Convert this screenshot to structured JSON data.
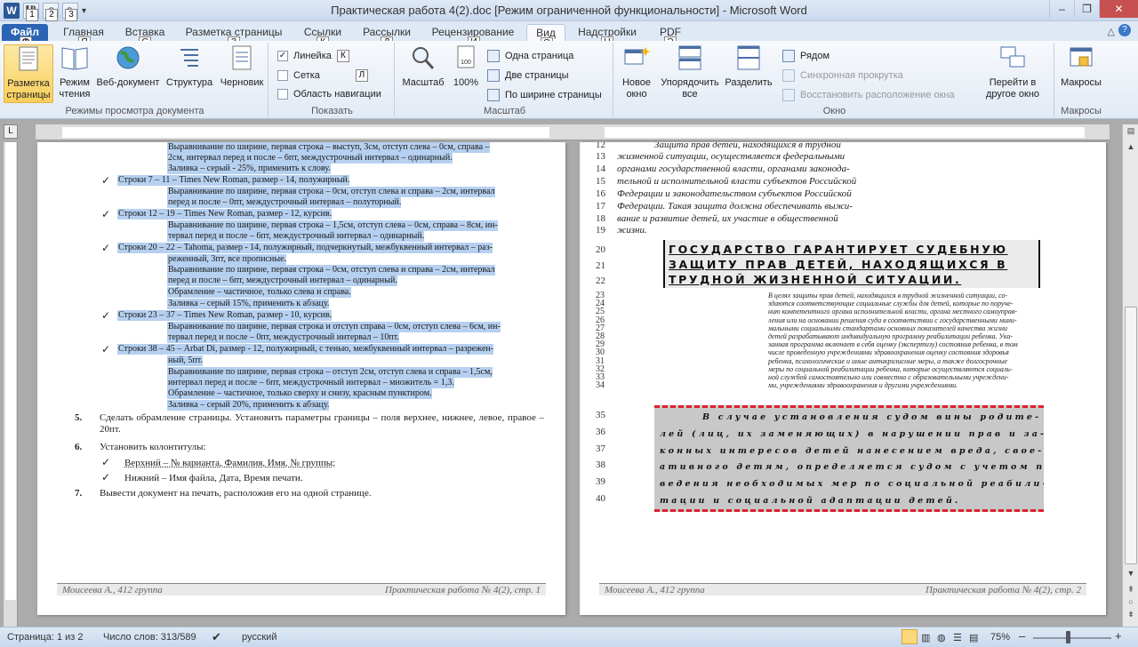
{
  "window": {
    "title": "Практическая работа 4(2).doc [Режим ограниченной функциональности]  -  Microsoft Word",
    "minimize": "–",
    "maximize": "❐",
    "close": "✕"
  },
  "qat": {
    "app_letter": "W",
    "keytips": [
      "1",
      "2",
      "3"
    ]
  },
  "tabs": [
    {
      "label": "Файл",
      "keytip": "Ф"
    },
    {
      "label": "Главная",
      "keytip": "Я"
    },
    {
      "label": "Вставка",
      "keytip": "С"
    },
    {
      "label": "Разметка страницы",
      "keytip": "З"
    },
    {
      "label": "Ссылки",
      "keytip": "К"
    },
    {
      "label": "Рассылки",
      "keytip": "Л"
    },
    {
      "label": "Рецензирование",
      "keytip": "И"
    },
    {
      "label": "Вид",
      "keytip": "О"
    },
    {
      "label": "Надстройки",
      "keytip": "Н"
    },
    {
      "label": "PDF",
      "keytip": "Э"
    }
  ],
  "ribbon": {
    "view_modes": {
      "label": "Режимы просмотра документа",
      "buttons": [
        "Разметка страницы",
        "Режим чтения",
        "Веб-документ",
        "Структура",
        "Черновик"
      ]
    },
    "show": {
      "label": "Показать",
      "items": [
        {
          "label": "Линейка",
          "checked": true
        },
        {
          "label": "Сетка",
          "checked": false
        },
        {
          "label": "Область навигации",
          "checked": false
        }
      ]
    },
    "zoom": {
      "label": "Масштаб",
      "zoom_btn": "Масштаб",
      "hundred_btn": "100%",
      "items": [
        "Одна страница",
        "Две страницы",
        "По ширине страницы"
      ]
    },
    "window": {
      "label": "Окно",
      "buttons": [
        "Новое окно",
        "Упорядочить все",
        "Разделить"
      ],
      "items": [
        "Рядом",
        "Синхронная прокрутка",
        "Восстановить расположение окна"
      ],
      "switch_btn": "Перейти в другое окно"
    },
    "macros": {
      "label": "Макросы",
      "button": "Макросы"
    }
  },
  "page1": {
    "selected_lines": [
      "Выравнивание по ширине, первая строка – выступ, 3см, отступ слева – 0см, справа –",
      "2см, интервал перед и после – 6пт, междустрочный интервал – одинарный.",
      "Заливка – серый - 25%, применить к слову.",
      "Строки 7 – 11 – Times New Roman, размер - 14, полужирный.",
      "Выравнивание по ширине, первая строка – 0см, отступ слева и справа – 2см, интервал",
      "перед и после – 0пт, междустрочный интервал – полуторный.",
      "Строки 12 – 19 – Times New Roman, размер - 12, курсив.",
      "Выравнивание по ширине, первая строка – 1,5см, отступ слева – 0см, справа – 8см, ин-",
      "тервал перед и после – 6пт, междустрочный интервал – одинарный.",
      "Строки 20 – 22 – Tahoma, размер - 14, полужирный, подчеркнутый, межбуквенный интервал – раз-",
      "реженный, 3пт, все прописные.",
      "Выравнивание по ширине, первая строка – 0см, отступ слева и справа – 2см, интервал",
      "перед и после – 6пт, междустрочный интервал – одинарный.",
      "Обрамление – частичное, только слева и справа.",
      "Заливка – серый 15%, применить к абзацу.",
      "Строки 23 – 37 – Times New Roman, размер - 10, курсив.",
      "Выравнивание по ширине, первая строка и отступ справа – 0см, отступ слева – 6см, ин-",
      "тервал перед и после – 0пт, междустрочный интервал – 10пт.",
      "Строки 38 – 45 – Arbat Di, размер - 12, полужирный, с тенью, межбуквенный интервал – разрежен-",
      "ный, 5пт.",
      "Выравнивание по ширине, первая строка – отступ 2см, отступ слева и справа – 1,5см,",
      "интервал перед и после – 6пт, междустрочный интервал – множитель = 1,3.",
      "Обрамление – частичное, только сверху и снизу, красным пунктиром.",
      "Заливка – серый 20%, применить к абзацу."
    ],
    "items": [
      {
        "num": "5.",
        "text": "Сделать обрамление страницы. Установить параметры границы – поля верхнее, нижнее, левое, правое – 20пт."
      },
      {
        "num": "6.",
        "text": "Установить колонтитулы:"
      },
      {
        "num": "",
        "text": "Верхний – № варианта, Фамилия, Имя, № группы;",
        "tick": "✓"
      },
      {
        "num": "",
        "text": "Нижний – Имя файла, Дата, Время печати.",
        "tick": "✓"
      },
      {
        "num": "7.",
        "text": "Вывести документ на печать, расположив его на одной странице."
      }
    ],
    "footer_left": "Моисеева А., 412 группа",
    "footer_right": "Практическая работа № 4(2), стр. 1"
  },
  "page2": {
    "lines_a": [
      {
        "n": "12",
        "t": "Защита прав детей, находящихся в трудной"
      },
      {
        "n": "13",
        "t": "жизненной ситуации, осуществляется федеральными"
      },
      {
        "n": "14",
        "t": "органами государственной власти, органами законода-"
      },
      {
        "n": "15",
        "t": "тельной и исполнительной власти субъектов Российской"
      },
      {
        "n": "16",
        "t": "Федерации и законодательством субъектов Российской"
      },
      {
        "n": "17",
        "t": "Федерации. Такая защита должна обеспечивать выжи-"
      },
      {
        "n": "18",
        "t": "вание и развитие детей, их участие в общественной"
      },
      {
        "n": "19",
        "t": "жизни."
      }
    ],
    "heading_nums": [
      "20",
      "21",
      "22"
    ],
    "heading_lines": [
      "ГОСУДАРСТВО ГАРАНТИРУЕТ СУДЕБНУЮ",
      "ЗАЩИТУ ПРАВ ДЕТЕЙ, НАХОДЯЩИХСЯ В",
      "ТРУДНОЙ ЖИЗНЕННОЙ СИТУАЦИИ."
    ],
    "small_nums": [
      "23",
      "24",
      "25",
      "26",
      "27",
      "28",
      "29",
      "30",
      "31",
      "32",
      "33",
      "34"
    ],
    "small_lines": [
      "В целях защиты прав детей, находящихся в трудной жизненной ситуации, со-",
      "здаются соответствующие социальные службы для детей, которые по поруче-",
      "нию компетентного органа исполнительной власти, органа местного самоуправ-",
      "ления или на основании решения суда в соответствии с государственными мини-",
      "мальными социальными стандартами основных показателей качества жизни",
      "детей разрабатывают индивидуальную программу реабилитации ребенка. Ука-",
      "занная программа включает в себя оценку (экспертизу) состояния ребенка, в том",
      "числе проведенную учреждениями здравоохранения оценку состояния здоровья",
      "ребенка, психологические и иные антикризисные меры, а также долгосрочные",
      "меры по социальной реабилитации ребенка, которые осуществляются социаль-",
      "ной службой самостоятельно или совместно с образовательными учреждени-",
      "ми, учреждениями здравоохранения и другими учреждениями."
    ],
    "box_nums": [
      "35",
      "36",
      "37",
      "38",
      "39",
      "40"
    ],
    "box_lines": [
      "В случае установления судом вины родите-",
      "лей (лиц, их заменяющих) в нарушении прав и за-",
      "конных интересов детей нанесением вреда, свое-",
      "ативного детям, определяется судом с учетом про-",
      "ведения необходимых мер по социальной реабили-",
      "тации и социальной адаптации детей."
    ],
    "footer_left": "Моисеева А., 412 группа",
    "footer_right": "Практическая работа № 4(2), стр. 2"
  },
  "status": {
    "page": "Страница: 1 из 2",
    "words": "Число слов: 313/589",
    "lang": "русский",
    "zoom": "75%",
    "minus": "–",
    "plus": "+"
  }
}
